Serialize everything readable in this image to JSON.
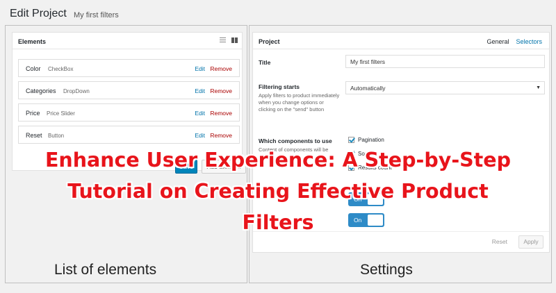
{
  "header": {
    "title": "Edit Project",
    "project_name": "My first filters"
  },
  "elements_panel": {
    "title": "Elements",
    "icons": [
      "list-view-icon",
      "grid-view-icon"
    ],
    "rows": [
      {
        "label": "Color",
        "type": "CheckBox",
        "edit": "Edit",
        "remove": "Remove"
      },
      {
        "label": "Categories",
        "type": "DropDown",
        "edit": "Edit",
        "remove": "Remove"
      },
      {
        "label": "Price",
        "type": "Price Slider",
        "edit": "Edit",
        "remove": "Remove"
      },
      {
        "label": "Reset",
        "type": "Button",
        "edit": "Edit",
        "remove": "Remove"
      }
    ],
    "save_label": "Save",
    "add_label": "Add Element",
    "caption": "List of elements"
  },
  "settings_panel": {
    "title": "Project",
    "tabs": [
      "General",
      "Selectors"
    ],
    "title_field": {
      "label": "Title",
      "value": "My first filters"
    },
    "filtering_starts": {
      "label": "Filtering starts",
      "description": "Apply filters to product immediately when you change options or clicking on the \"send\" button",
      "value": "Automatically"
    },
    "components": {
      "label": "Which components to use",
      "description": "Content of components will be",
      "options": [
        "Pagination",
        "Sorting",
        "Results count"
      ]
    },
    "toggle_label": "On",
    "reset_label": "Reset",
    "apply_label": "Apply",
    "caption": "Settings"
  },
  "overlay": {
    "line1": "Enhance User Experience: A Step-by-Step",
    "line2": "Tutorial on Creating Effective Product",
    "line3": "Filters"
  },
  "colors": {
    "accent": "#0085ba",
    "link": "#0073aa",
    "remove": "#aa0000",
    "toggle": "#2e8bc7",
    "overlay_text": "#e8141b"
  }
}
